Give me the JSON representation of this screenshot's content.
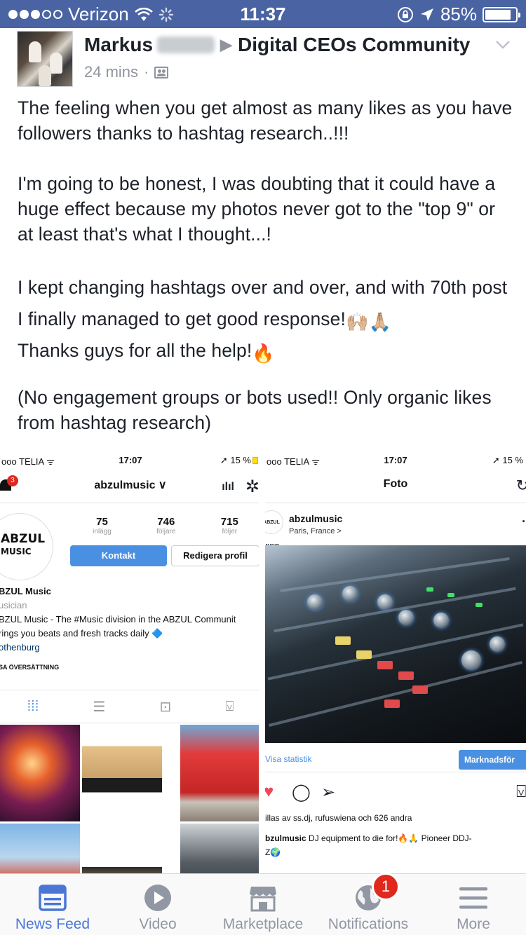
{
  "status_bar": {
    "carrier": "Verizon",
    "time": "11:37",
    "battery": "85%",
    "battery_level": 0.85
  },
  "post": {
    "author": "Markus",
    "target_group": "Digital CEOs Community",
    "time_ago": "24 mins",
    "paragraphs": [
      "The feeling when you get almost as many likes as you have followers thanks to hashtag research..!!!",
      "I'm going to be honest, I was doubting that it could have a huge effect because my photos never got to the \"top 9\" or at least that's what I thought...!",
      "I kept changing hashtags over and over, and with 70th post I finally managed to get good response!",
      "Thanks guys for all the help!",
      "(No engagement groups or bots used!! Only organic likes from hashtag research)"
    ],
    "emoji_1": "🙌🏼🙏🏼",
    "emoji_2": "🔥"
  },
  "screenshot_left": {
    "carrier": "TELIA",
    "time": "17:07",
    "battery": "15 %",
    "notification_count": "3",
    "username": "abzulmusic ∨",
    "logo_line1": "ABZUL",
    "logo_line2": "MUSIC",
    "stats": [
      {
        "num": "75",
        "label": "inlägg"
      },
      {
        "num": "746",
        "label": "följare"
      },
      {
        "num": "715",
        "label": "följer"
      }
    ],
    "contact_button": "Kontakt",
    "edit_button": "Redigera profil",
    "bio_name": "BZUL Music",
    "bio_category": "usician",
    "bio_line1": "BZUL Music - The #Music division in the ABZUL Communit",
    "bio_line2": "rings you beats and fresh tracks daily 🔷",
    "bio_location": "othenburg",
    "bio_translate": "SA ÖVERSÄTTNING"
  },
  "screenshot_right": {
    "carrier": "TELIA",
    "time": "17:07",
    "battery": "15 %",
    "title": "Foto",
    "username": "abzulmusic",
    "location": "Paris, France >",
    "mini_logo": "ABZUL MUSIC",
    "view_stats": "Visa statistik",
    "marketing_button": "Marknadsför",
    "likes": "illas av ss.dj, rufuswiena och 626 andra",
    "caption_user": "bzulmusic",
    "caption_text": "DJ equipment to die for!🔥🙏 Pioneer DDJ-",
    "caption_text2": "Z🌍"
  },
  "tabbar": {
    "items": [
      {
        "label": "News Feed",
        "icon": "news-feed-icon",
        "active": true
      },
      {
        "label": "Video",
        "icon": "video-icon"
      },
      {
        "label": "Marketplace",
        "icon": "marketplace-icon"
      },
      {
        "label": "Notifications",
        "icon": "notifications-icon",
        "badge": "1"
      },
      {
        "label": "More",
        "icon": "more-icon"
      }
    ]
  },
  "colors": {
    "status_bar": "#4a64a3",
    "facebook_blue": "#4a76d6",
    "badge_red": "#e0281d",
    "instagram_blue": "#4a90e2"
  }
}
